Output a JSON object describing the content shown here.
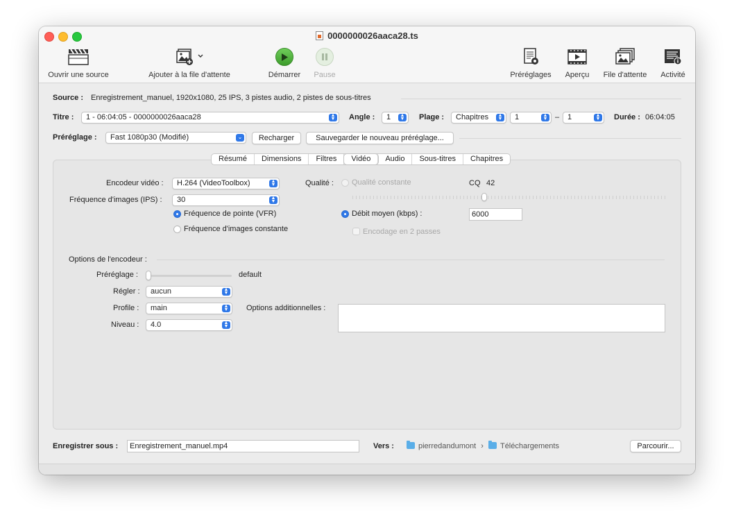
{
  "window": {
    "title": "0000000026aaca28.ts"
  },
  "toolbar": {
    "open_source": "Ouvrir une source",
    "add_queue": "Ajouter à la file d'attente",
    "start": "Démarrer",
    "pause": "Pause",
    "presets": "Préréglages",
    "preview": "Aperçu",
    "queue": "File d'attente",
    "activity": "Activité"
  },
  "source": {
    "label": "Source :",
    "value": "Enregistrement_manuel, 1920x1080, 25 IPS, 3 pistes audio, 2 pistes de sous-titres"
  },
  "title_row": {
    "title_label": "Titre :",
    "title_value": "1 - 06:04:05 - 0000000026aaca28",
    "angle_label": "Angle :",
    "angle_value": "1",
    "range_label": "Plage :",
    "range_type": "Chapitres",
    "range_start": "1",
    "range_sep": "–",
    "range_end": "1",
    "duration_label": "Durée :",
    "duration_value": "06:04:05"
  },
  "preset_row": {
    "label": "Préréglage :",
    "value": "Fast 1080p30 (Modifié)",
    "reload": "Recharger",
    "save_new": "Sauvegarder le nouveau préréglage..."
  },
  "tabs": [
    "Résumé",
    "Dimensions",
    "Filtres",
    "Vidéo",
    "Audio",
    "Sous-titres",
    "Chapitres"
  ],
  "selected_tab": "Vidéo",
  "video": {
    "encoder_label": "Encodeur vidéo :",
    "encoder_value": "H.264 (VideoToolbox)",
    "fps_label": "Fréquence d'images (IPS) :",
    "fps_value": "30",
    "vfr_label": "Fréquence de pointe (VFR)",
    "cfr_label": "Fréquence d'images constante",
    "quality_label": "Qualité :",
    "cq_label": "Qualité constante",
    "cq_prefix": "CQ",
    "cq_value": "42",
    "abr_label": "Débit moyen (kbps) :",
    "abr_value": "6000",
    "twopass_label": "Encodage en 2 passes"
  },
  "encoder_options": {
    "header": "Options de l'encodeur :",
    "preset_label": "Préréglage :",
    "preset_value": "default",
    "tune_label": "Régler :",
    "tune_value": "aucun",
    "profile_label": "Profile :",
    "profile_value": "main",
    "level_label": "Niveau :",
    "level_value": "4.0",
    "additional_label": "Options additionnelles :"
  },
  "save": {
    "label": "Enregistrer sous :",
    "filename": "Enregistrement_manuel.mp4",
    "to_label": "Vers :",
    "path_user": "pierredandumont",
    "path_sep": "›",
    "path_folder": "Téléchargements",
    "browse": "Parcourir..."
  }
}
